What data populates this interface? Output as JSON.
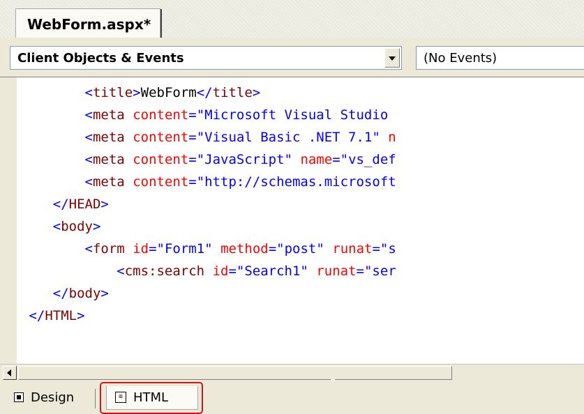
{
  "document_tab": {
    "label": "WebForm.aspx*"
  },
  "dropdowns": {
    "objects_selected": "Client Objects & Events",
    "events_selected": "(No Events)"
  },
  "code_lines": [
    {
      "indent": "        ",
      "parts": [
        [
          "br",
          "<"
        ],
        [
          "tag",
          "title"
        ],
        [
          "br",
          ">"
        ],
        [
          "text",
          "WebForm"
        ],
        [
          "br",
          "</"
        ],
        [
          "tag",
          "title"
        ],
        [
          "br",
          ">"
        ]
      ]
    },
    {
      "indent": "        ",
      "parts": [
        [
          "br",
          "<"
        ],
        [
          "tag",
          "meta"
        ],
        [
          "text",
          " "
        ],
        [
          "attr",
          "content"
        ],
        [
          "br",
          "="
        ],
        [
          "val",
          "\"Microsoft Visual Studio"
        ]
      ]
    },
    {
      "indent": "        ",
      "parts": [
        [
          "br",
          "<"
        ],
        [
          "tag",
          "meta"
        ],
        [
          "text",
          " "
        ],
        [
          "attr",
          "content"
        ],
        [
          "br",
          "="
        ],
        [
          "val",
          "\"Visual Basic .NET 7.1\""
        ],
        [
          "text",
          " "
        ],
        [
          "attr",
          "n"
        ]
      ]
    },
    {
      "indent": "        ",
      "parts": [
        [
          "br",
          "<"
        ],
        [
          "tag",
          "meta"
        ],
        [
          "text",
          " "
        ],
        [
          "attr",
          "content"
        ],
        [
          "br",
          "="
        ],
        [
          "val",
          "\"JavaScript\""
        ],
        [
          "text",
          " "
        ],
        [
          "attr",
          "name"
        ],
        [
          "br",
          "="
        ],
        [
          "val",
          "\"vs_def"
        ]
      ]
    },
    {
      "indent": "        ",
      "parts": [
        [
          "br",
          "<"
        ],
        [
          "tag",
          "meta"
        ],
        [
          "text",
          " "
        ],
        [
          "attr",
          "content"
        ],
        [
          "br",
          "="
        ],
        [
          "val",
          "\"http://schemas.microsoft"
        ]
      ]
    },
    {
      "indent": "    ",
      "parts": [
        [
          "br",
          "</"
        ],
        [
          "tag",
          "HEAD"
        ],
        [
          "br",
          ">"
        ]
      ]
    },
    {
      "indent": "    ",
      "parts": [
        [
          "br",
          "<"
        ],
        [
          "tag",
          "body"
        ],
        [
          "br",
          ">"
        ]
      ]
    },
    {
      "indent": "        ",
      "parts": [
        [
          "br",
          "<"
        ],
        [
          "tag",
          "form"
        ],
        [
          "text",
          " "
        ],
        [
          "attr",
          "id"
        ],
        [
          "br",
          "="
        ],
        [
          "val",
          "\"Form1\""
        ],
        [
          "text",
          " "
        ],
        [
          "attr",
          "method"
        ],
        [
          "br",
          "="
        ],
        [
          "val",
          "\"post\""
        ],
        [
          "text",
          " "
        ],
        [
          "attr",
          "runat"
        ],
        [
          "br",
          "="
        ],
        [
          "val",
          "\"s"
        ]
      ]
    },
    {
      "indent": "            ",
      "parts": [
        [
          "br",
          "<"
        ],
        [
          "tag",
          "cms:search"
        ],
        [
          "text",
          " "
        ],
        [
          "attr",
          "id"
        ],
        [
          "br",
          "="
        ],
        [
          "val",
          "\"Search1\""
        ],
        [
          "text",
          " "
        ],
        [
          "attr",
          "runat"
        ],
        [
          "br",
          "="
        ],
        [
          "val",
          "\"ser"
        ]
      ]
    },
    {
      "indent": "    ",
      "parts": [
        [
          "br",
          "</"
        ],
        [
          "tag",
          "body"
        ],
        [
          "br",
          ">"
        ]
      ]
    },
    {
      "indent": " ",
      "parts": [
        [
          "br",
          "</"
        ],
        [
          "tag",
          "HTML"
        ],
        [
          "br",
          ">"
        ]
      ]
    }
  ],
  "view_tabs": {
    "design_label": "Design",
    "html_label": "HTML"
  },
  "colors": {
    "tag": "#800000",
    "bracket": "#0000ff",
    "attribute": "#ff0000",
    "value": "#0000ff",
    "highlight": "#d0161b"
  },
  "icons": {
    "design_tab": "design-view-icon",
    "html_tab": "html-view-icon",
    "objects_dropdown": "chevron-down-icon",
    "scroll_left": "arrow-left-icon"
  }
}
